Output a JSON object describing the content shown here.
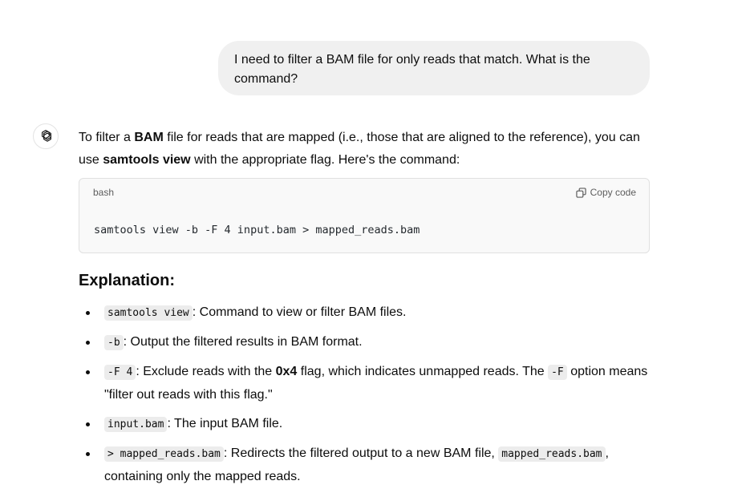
{
  "user_message": {
    "text": "I need to filter a BAM file for only reads that match. What is the command?"
  },
  "assistant": {
    "avatar_icon": "openai-logo-icon",
    "intro": {
      "p1": "To filter a ",
      "b1": "BAM",
      "p2": " file for reads that are mapped (i.e., those that are aligned to the reference), you can use ",
      "b2": "samtools view",
      "p3": " with the appropriate flag. Here's the command:"
    },
    "code_block": {
      "language": "bash",
      "copy_label": "Copy code",
      "copy_icon": "copy-icon",
      "code": "samtools view -b -F 4 input.bam > mapped_reads.bam"
    },
    "explanation_heading": "Explanation:",
    "bullets": [
      {
        "code": "samtools view",
        "text": ": Command to view or filter BAM files."
      },
      {
        "code": "-b",
        "text": ": Output the filtered results in BAM format."
      },
      {
        "code": "-F 4",
        "text_before": ": Exclude reads with the ",
        "bold": "0x4",
        "text_middle": " flag, which indicates unmapped reads. The ",
        "code2": "-F",
        "text_after": " option means \"filter out reads with this flag.\""
      },
      {
        "code": "input.bam",
        "text": ": The input BAM file."
      },
      {
        "code": "> mapped_reads.bam",
        "text_before": ": Redirects the filtered output to a new BAM file, ",
        "code2": "mapped_reads.bam",
        "text_after": ", containing only the mapped reads."
      }
    ]
  }
}
